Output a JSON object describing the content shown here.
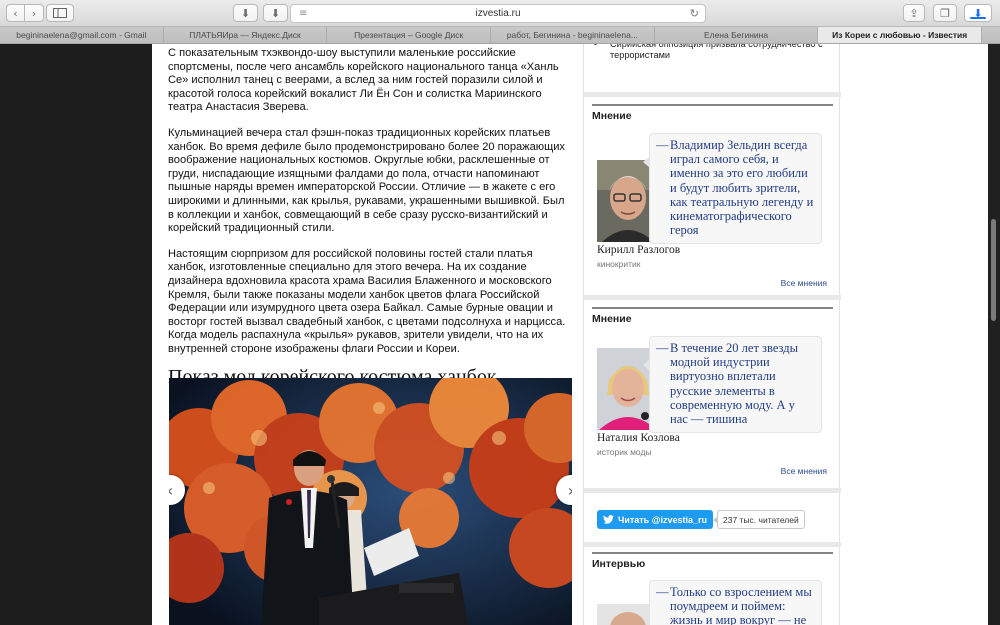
{
  "browser": {
    "url": "izvestia.ru",
    "tabs": [
      "begininaelena@gmail.com - Gmail",
      "ПЛАТЬЯИра — Яндекс.Диск",
      "Презентация – Google Диск",
      "работ, Бегинина - begininaelena...",
      "Елена Бегинина",
      "Из Кореи с любовью - Известия"
    ],
    "active_tab": 5
  },
  "article": {
    "paragraphs": [
      "С показательным тхэквондо-шоу выступили маленькие российские спортсмены, после чего ансамбль корейского национального танца «Ханль Се» исполнил танец с веерами, а вслед за ним гостей поразили силой и красотой голоса корейский вокалист Ли Ён Сон и солистка Мариинского театра Анастасия Зверева.",
      "Кульминацией вечера стал фэшн-показ традиционных корейских платьев ханбок. Во время дефиле было продемонстрировано более 20 поражающих воображение национальных костюмов. Округлые юбки, расклешенные от груди, ниспадающие изящными фалдами до пола, отчасти напоминают пышные наряды времен императорской России. Отличие — в жакете с его широкими и длинными, как крылья, рукавами, украшенными вышивкой. Был в коллекции и ханбок, совмещающий в себе сразу русско-византийский и корейский традиционный стили.",
      "Настоящим сюрпризом для российской половины гостей стали платья ханбок, изготовленные специально для этого вечера. На их создание дизайнера вдохновила красота храма Василия Блаженного и московского Кремля, были также показаны модели ханбок цветов флага Российской Федерации или изумрудного цвета озера Байкал. Самые бурные овации и восторг гостей вызвал свадебный ханбок, с цветами подсолнуха и нарцисса. Когда модель распахнула «крылья» рукавов, зрители увидели, что на их внутренней стороне изображены флаги России и Кореи."
    ],
    "heading": "Показ мод корейского костюма ханбок"
  },
  "sidebar": {
    "top_item": "Сирийская оппозиция призвала сотрудничество с террористами",
    "opinions": [
      {
        "header": "Мнение",
        "quote": "Владимир Зельдин всегда играл самого себя, и именно за это его любили и будут любить зрители, как театральную легенду и кинематографического героя",
        "name": "Кирилл Разлогов",
        "role": "кинокритик",
        "all_link": "Все мнения"
      },
      {
        "header": "Мнение",
        "quote": "В течение 20 лет звезды модной индустрии виртуозно вплетали русские элементы в современную моду. А у нас — тишина",
        "name": "Наталия Козлова",
        "role": "историк моды",
        "all_link": "Все мнения"
      }
    ],
    "twitter": {
      "label": "Читать @izvestia_ru",
      "count": "237 тыс. читателей"
    },
    "interview": {
      "header": "Интервью",
      "quote": "Только со взрослением мы поумдреем и поймем: жизнь и мир вокруг — не"
    }
  },
  "colors": {
    "quote_text": "#223c86",
    "twitter": "#1d9bf0",
    "link": "#2b4a8e"
  }
}
